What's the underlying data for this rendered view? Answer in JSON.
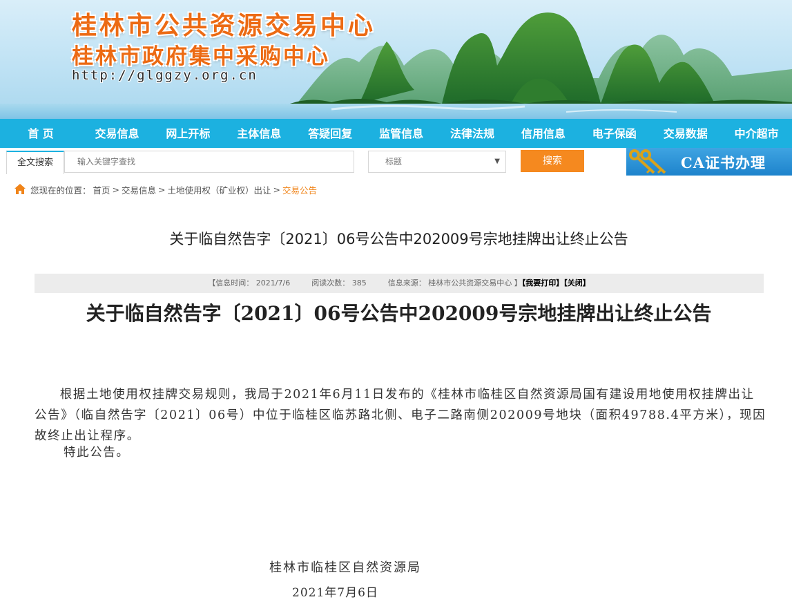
{
  "header": {
    "title_main": "桂林市公共资源交易中心",
    "title_sub": "桂林市政府集中采购中心",
    "site_url": "http://glggzy.org.cn"
  },
  "nav": {
    "items": [
      "首 页",
      "交易信息",
      "网上开标",
      "主体信息",
      "答疑回复",
      "监管信息",
      "法律法规",
      "信用信息",
      "电子保函",
      "交易数据",
      "中介超市"
    ]
  },
  "search": {
    "tab_label": "全文搜索",
    "placeholder": "输入关键字查找",
    "select_value": "标题",
    "button_label": "搜索"
  },
  "ca_banner": {
    "label": "CA证书办理"
  },
  "breadcrumb": {
    "prefix": "您现在的位置：",
    "items": [
      "首页",
      "交易信息",
      "土地使用权（矿业权）出让"
    ],
    "current": "交易公告",
    "separator": ">"
  },
  "article": {
    "title": "关于临自然告字〔2021〕06号公告中202009号宗地挂牌出让终止公告",
    "info": {
      "date_label": "【信息时间：",
      "date": "2021/7/6",
      "views_label": "阅读次数：",
      "views": "385",
      "source_label": "信息来源：",
      "source": "桂林市公共资源交易中心",
      "close_bracket": "】",
      "print_label": "【我要打印】",
      "close_label": "【关闭】"
    },
    "doc_title": "关于临自然告字〔2021〕06号公告中202009号宗地挂牌出让终止公告",
    "body": "根据土地使用权挂牌交易规则，我局于2021年6月11日发布的《桂林市临桂区自然资源局国有建设用地使用权挂牌出让公告》（临自然告字〔2021〕06号）中位于临桂区临苏路北侧、电子二路南侧202009号地块（面积49788.4平方米），现因故终止出让程序。",
    "closing": "特此公告。",
    "org": "桂林市临桂区自然资源局",
    "date": "2021年7月6日"
  },
  "colors": {
    "nav_bg": "#1cb1e0",
    "title_orange": "#ec6a13",
    "search_button": "#f5891f",
    "crumb_current": "#f08419",
    "info_bar_bg": "#ececec"
  },
  "icons": {
    "breadcrumb": "home-icon",
    "select": "dropdown-arrow-icon",
    "ca": "keys-icon"
  }
}
